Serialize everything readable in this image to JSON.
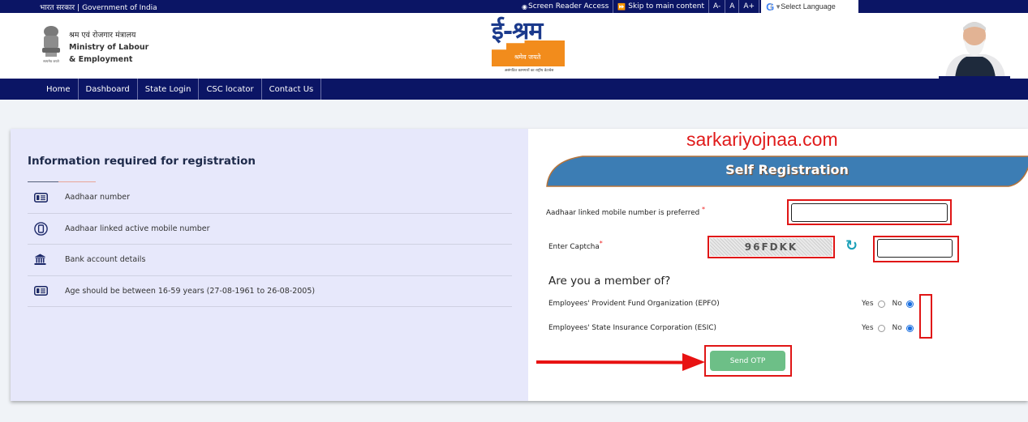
{
  "topbar": {
    "gov_hindi": "भारत सरकार",
    "gov_english": "Government of India",
    "links": [
      "Screen Reader Access",
      "Skip to main content",
      "A-",
      "A",
      "A+"
    ],
    "language_select": "Select Language"
  },
  "header": {
    "ministry_hindi": "श्रम एवं रोजगार मंत्रालय",
    "ministry_line1": "Ministry of Labour",
    "ministry_line2": "& Employment",
    "emblem_caption": "सत्यमेव जयते",
    "logo_title": "ई-श्रम",
    "logo_motto": "श्रमेव जयते",
    "logo_tagline": "असंगठित कामगारों का राष्ट्रीय डेटाबेस"
  },
  "nav": {
    "items": [
      "Home",
      "Dashboard",
      "State Login",
      "CSC locator",
      "Contact Us"
    ]
  },
  "info": {
    "title": "Information required for registration",
    "items": [
      {
        "icon": "id-card-icon",
        "text": "Aadhaar number"
      },
      {
        "icon": "mobile-icon",
        "text": "Aadhaar linked active mobile number"
      },
      {
        "icon": "bank-icon",
        "text": "Bank account details"
      },
      {
        "icon": "id-card-icon",
        "text": "Age should be between 16-59 years (27-08-1961 to 26-08-2005)"
      }
    ]
  },
  "form": {
    "watermark": "sarkariyojnaa.com",
    "title": "Self Registration",
    "mobile_label": "Aadhaar linked mobile number is preferred",
    "mobile_value": "",
    "captcha_label": "Enter Captcha",
    "captcha_text": "96FDKK",
    "captcha_value": "",
    "required_mark": "*",
    "member_heading": "Are you a member of?",
    "memberships": [
      {
        "label": "Employees' Provident Fund Organization (EPFO)",
        "yes": "Yes",
        "no": "No",
        "selected": "No"
      },
      {
        "label": "Employees' State Insurance Corporation (ESIC)",
        "yes": "Yes",
        "no": "No",
        "selected": "No"
      }
    ],
    "submit_label": "Send OTP"
  },
  "colors": {
    "navy": "#0b1565",
    "accent_blue": "#3a7fb5",
    "annotation_red": "#e01616",
    "button_green": "#6dbf87",
    "logo_orange": "#f28c1c"
  }
}
